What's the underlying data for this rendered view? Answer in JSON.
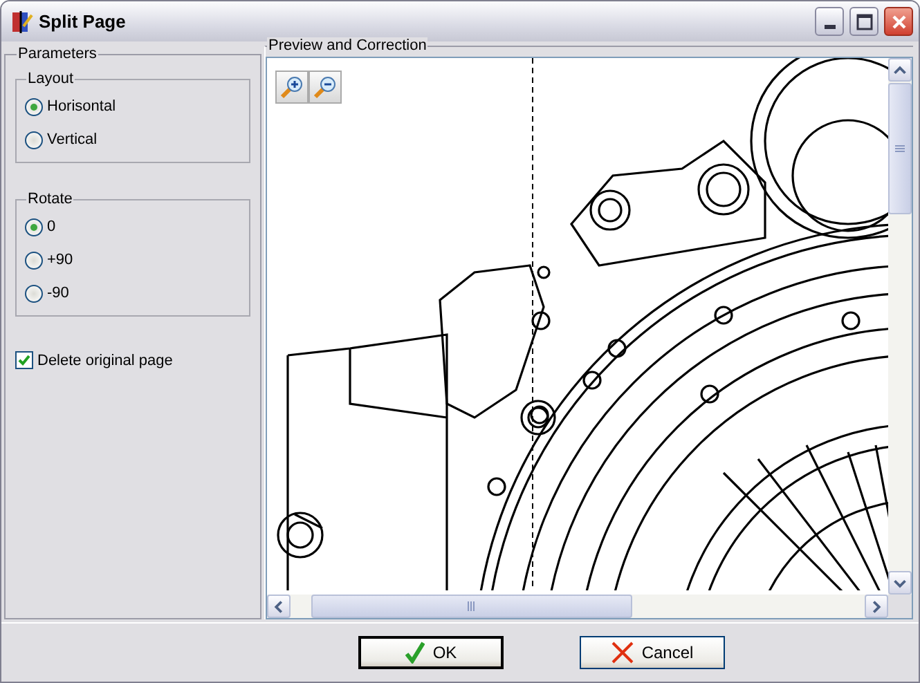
{
  "window": {
    "title": "Split Page"
  },
  "parameters": {
    "title": "Parameters",
    "groups": [
      {
        "title": "Layout",
        "options": [
          {
            "label": "Horisontal",
            "selected": true
          },
          {
            "label": "Vertical",
            "selected": false
          }
        ]
      },
      {
        "title": "Rotate",
        "options": [
          {
            "label": "0",
            "selected": true
          },
          {
            "label": "+90",
            "selected": false
          },
          {
            "label": "-90",
            "selected": false
          }
        ]
      }
    ],
    "delete_original": {
      "label": "Delete original page",
      "checked": true
    }
  },
  "preview": {
    "title": "Preview and Correction"
  },
  "buttons": [
    {
      "label": "OK",
      "kind": "ok"
    },
    {
      "label": "Cancel",
      "kind": "cancel"
    }
  ]
}
